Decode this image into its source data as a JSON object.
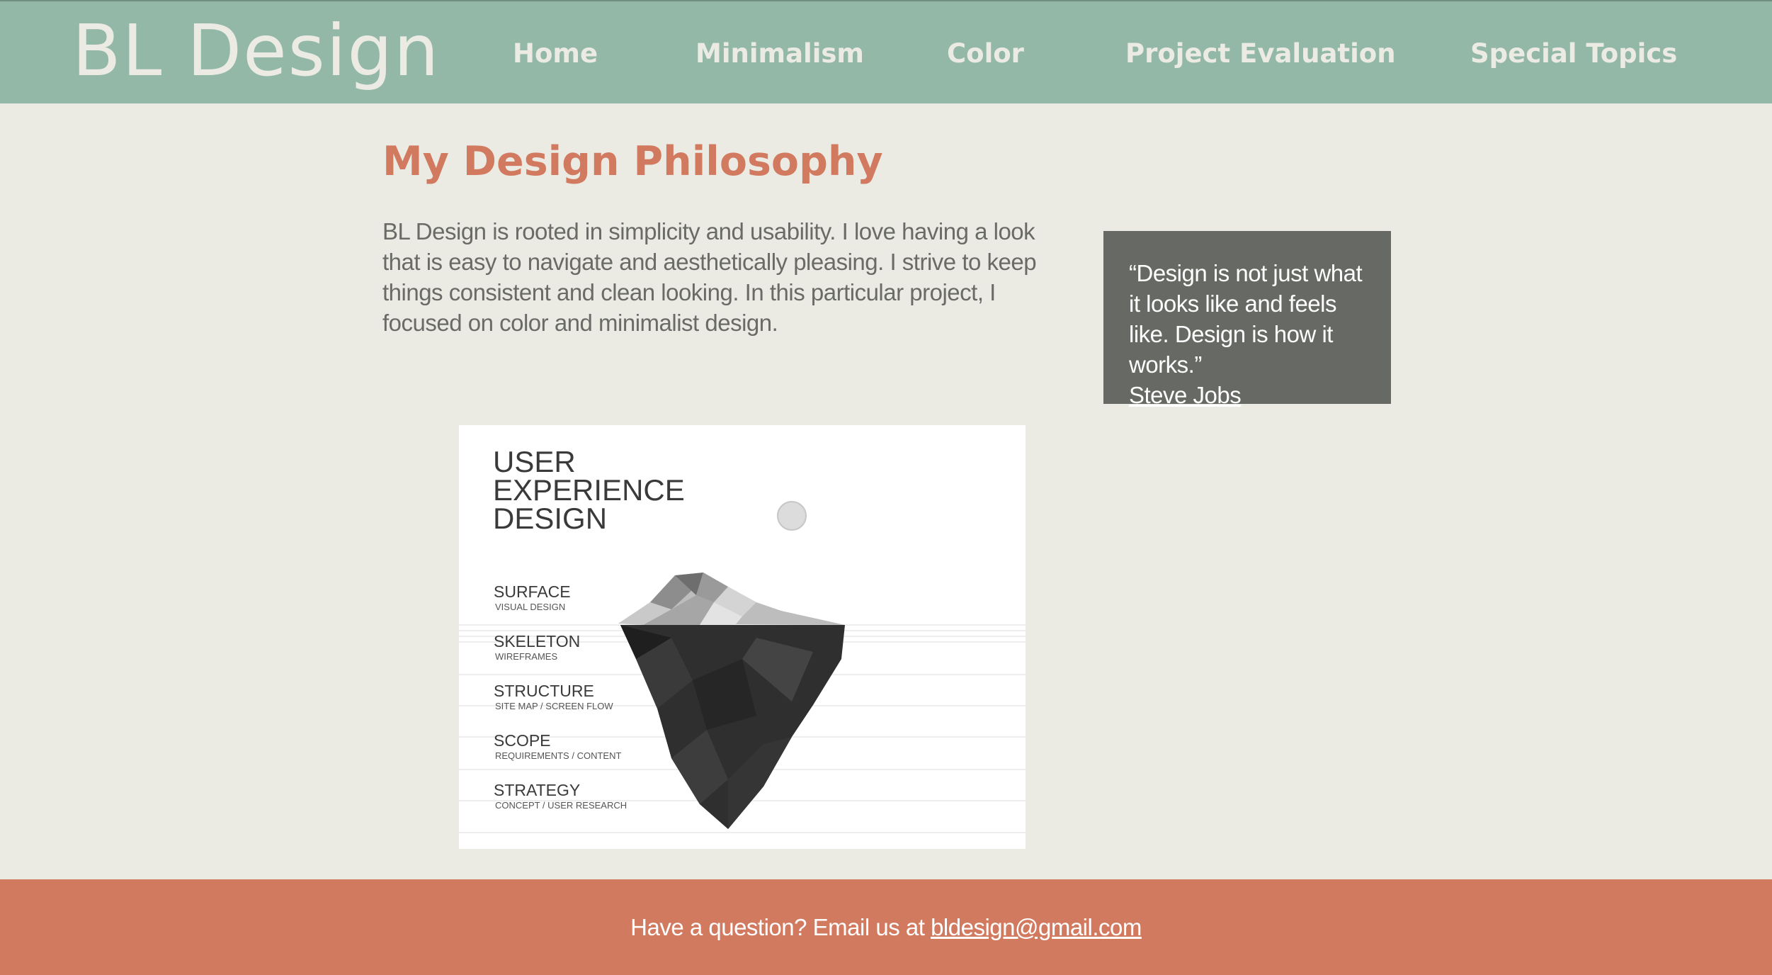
{
  "header": {
    "logo": "BL Design",
    "nav": [
      "Home",
      "Minimalism",
      "Color",
      "Project Evaluation",
      "Special Topics"
    ]
  },
  "main": {
    "title": "My Design Philosophy",
    "intro": "BL Design is rooted in simplicity and usability. I love having a look that is easy to navigate and aesthetically pleasing. I strive to keep things consistent and clean looking. In this particular project, I focused on color and minimalist design.",
    "quote": {
      "text": "“Design is not just what it looks like and feels like. Design is how it works.”",
      "author": "Steve Jobs"
    },
    "figure": {
      "title_lines": [
        "USER",
        "EXPERIENCE",
        "DESIGN"
      ],
      "layers": [
        {
          "name": "SURFACE",
          "sub": "VISUAL DESIGN"
        },
        {
          "name": "SKELETON",
          "sub": "WIREFRAMES"
        },
        {
          "name": "STRUCTURE",
          "sub": "SITE MAP / SCREEN FLOW"
        },
        {
          "name": "SCOPE",
          "sub": "REQUIREMENTS / CONTENT"
        },
        {
          "name": "STRATEGY",
          "sub": "CONCEPT / USER RESEARCH"
        }
      ]
    }
  },
  "footer": {
    "text": "Have a question? Email us at ",
    "email": "bldesign@gmail.com"
  },
  "colors": {
    "header_bg": "#94b8a8",
    "page_bg": "#ebebe4",
    "accent": "#d27a5f",
    "quote_bg": "#676964",
    "body_text": "#6a6b66"
  }
}
